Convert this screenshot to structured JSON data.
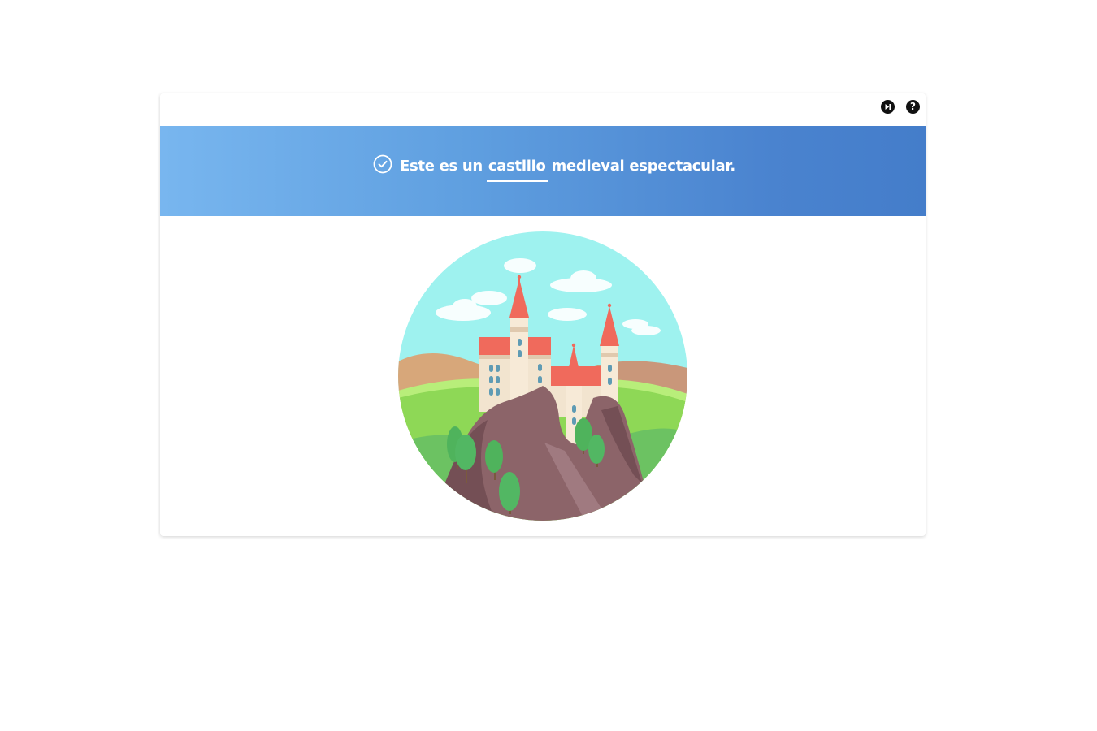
{
  "toolbar": {
    "skip_icon": "skip-forward-icon",
    "help_icon": "question-mark-icon",
    "help_glyph": "?"
  },
  "sentence": {
    "prefix": "Este es un",
    "answer": "castillo",
    "suffix": "medieval espectacular.",
    "status_icon": "check-circle-icon"
  },
  "illustration": {
    "subject": "castle-on-hill-illustration"
  },
  "colors": {
    "banner_start": "#78b6ef",
    "banner_end": "#447dca",
    "sky": "#9ef2ef",
    "roof": "#f06a5c",
    "rock": "#8c6469",
    "grass": "#8ed856",
    "tree": "#4fb35c"
  }
}
